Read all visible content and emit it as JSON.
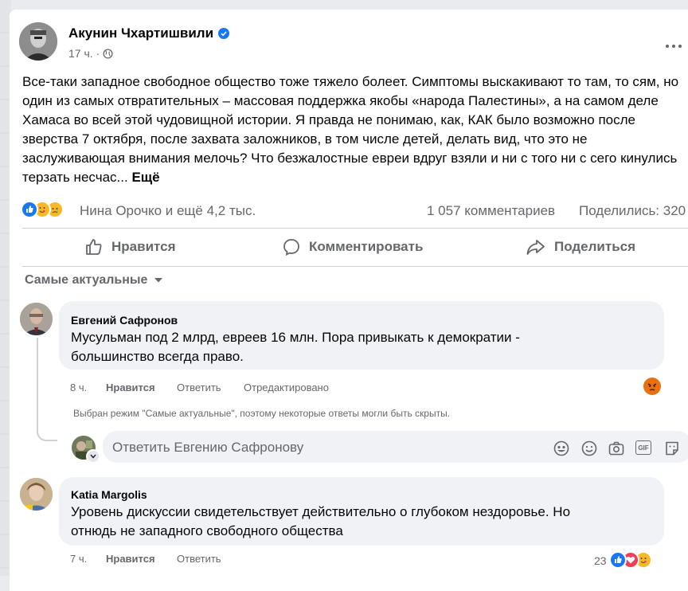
{
  "post": {
    "author": "Акунин Чхартишвили",
    "time": "17 ч.",
    "dot": "·",
    "text": "Все-таки западное свободное общество тоже тяжело болеет. Симптомы выскакивают то там, то сям, но один из самых отвратительных – массовая поддержка якобы «народа Палестины», а на самом деле Хамаса во всей этой чудовищной истории. Я правда не понимаю, как, КАК было возможно после зверства 7 октября, после захвата заложников, в том числе детей,  делать вид, что это не заслуживающая внимания мелочь? Что безжалостные евреи вдруг взяли  и ни с того ни с сего кинулись терзать несчас...",
    "more": "Ещё",
    "reactions_text": "Нина Орочко и ещё 4,2 тыс.",
    "comments_count": "1 057 комментариев",
    "shares_count": "Поделились: 320"
  },
  "actions": {
    "like": "Нравится",
    "comment": "Комментировать",
    "share": "Поделиться"
  },
  "sort": {
    "label": "Самые актуальные"
  },
  "comments": [
    {
      "author": "Евгений Сафронов",
      "text_line1": "Мусульман под 2 млрд, евреев 16 млн. Пора привыкать к демократии -",
      "text_line2": "большинство всегда право.",
      "time": "8 ч.",
      "like": "Нравится",
      "reply": "Ответить",
      "edited": "Отредактировано",
      "notice": "Выбран режим \"Самые актуальные\", поэтому некоторые ответы могли быть скрыты."
    },
    {
      "author": "Katia Margolis",
      "text_line1": "Уровень дискуссии свидетельствует действительно о глубоком нездоровье. Но",
      "text_line2": "отнюдь не западного свободного общества",
      "time": "7 ч.",
      "like": "Нравится",
      "reply": "Ответить",
      "reactions_count": "23"
    }
  ],
  "reply_box": {
    "placeholder": "Ответить Евгению Сафронову",
    "gif": "GIF"
  },
  "colors": {
    "like_blue": "#1877f2",
    "love_red": "#f33e58",
    "care_yellow": "#f7b928",
    "angry_orange": "#e9710f",
    "text_grey": "#65676b"
  }
}
